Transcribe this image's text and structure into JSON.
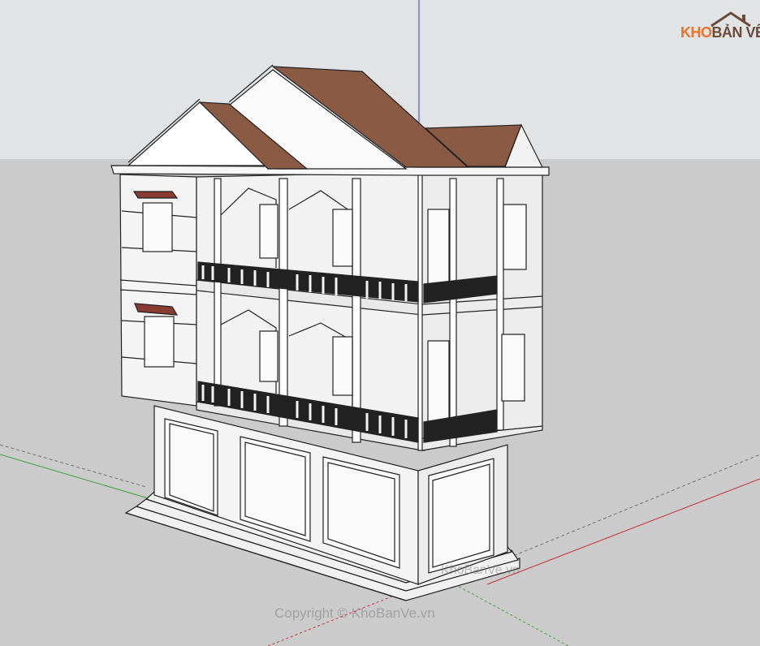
{
  "logo": {
    "part1": "KHO",
    "part2": "BẢN VẼ",
    "brand_color": "#e8742a",
    "house_color": "#6b4a3a"
  },
  "watermarks": {
    "center": "KhoBanVe.vn",
    "bottom": "Copyright © KhoBanVe.vn"
  },
  "colors": {
    "sky": "#e1e3e5",
    "ground": "#cbcbcb",
    "wall": "#f3f3f3",
    "roof": "#8a5a45",
    "awning": "#8a3b32",
    "axis_red": "#c8323c",
    "axis_green": "#3ca03c",
    "axis_blue": "#3c3cc8"
  },
  "icons": {
    "logo": "house-roof-icon"
  }
}
